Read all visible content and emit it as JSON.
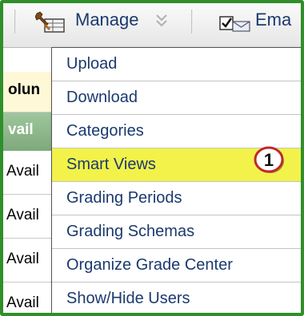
{
  "toolbar": {
    "manage_label": "Manage",
    "email_label": "Ema",
    "manage_icon": "wrench-table-icon",
    "email_icon": "checkbox-envelope-icon",
    "chevron_icon": "double-chevron-down-icon"
  },
  "grid": {
    "column_header_fragment": "olun",
    "header_row_fragment": "vail",
    "rows": [
      "Avail",
      "Avail",
      "Avail",
      "Avail"
    ]
  },
  "menu": {
    "items": [
      {
        "label": "Upload"
      },
      {
        "label": "Download"
      },
      {
        "label": "Categories"
      },
      {
        "label": "Smart Views",
        "highlighted": true
      },
      {
        "label": "Grading Periods"
      },
      {
        "label": "Grading Schemas"
      },
      {
        "label": "Organize Grade Center"
      },
      {
        "label": "Show/Hide Users"
      }
    ]
  },
  "callout": {
    "number": "1"
  },
  "colors": {
    "frame": "#2f8f2a",
    "highlight": "#f2f24a",
    "menu_text": "#1a3a6e",
    "callout_red": "#c0282d"
  }
}
